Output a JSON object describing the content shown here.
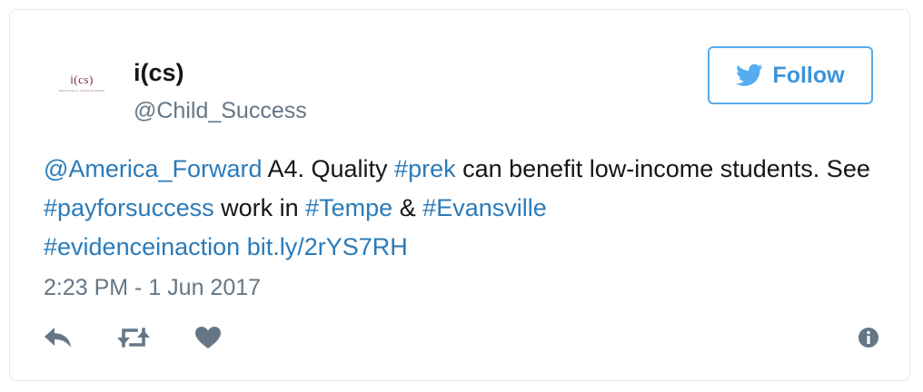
{
  "user": {
    "avatar_logo_text": "i(cs)",
    "avatar_logo_subtext": "INSTITUTE for CHILD SUCCESS",
    "name": "i(cs)",
    "handle": "@Child_Success"
  },
  "follow_button": {
    "label": "Follow",
    "icon": "twitter-bird-icon"
  },
  "tweet": {
    "segments": [
      {
        "text": "@America_Forward",
        "type": "mention"
      },
      {
        "text": " A4. Quality ",
        "type": "text"
      },
      {
        "text": "#prek",
        "type": "hashtag"
      },
      {
        "text": " can benefit low-income students. See ",
        "type": "text"
      },
      {
        "text": "#payforsuccess",
        "type": "hashtag"
      },
      {
        "text": " work in ",
        "type": "text"
      },
      {
        "text": "#Tempe",
        "type": "hashtag"
      },
      {
        "text": " & ",
        "type": "text"
      },
      {
        "text": "#Evansville",
        "type": "hashtag"
      },
      {
        "text": " ",
        "type": "text"
      },
      {
        "text": "#evidenceinaction",
        "type": "hashtag"
      },
      {
        "text": " ",
        "type": "text"
      },
      {
        "text": "bit.ly/2rYS7RH",
        "type": "url"
      }
    ],
    "timestamp": "2:23 PM - 1 Jun 2017"
  },
  "actions": [
    {
      "name": "reply-icon",
      "label": "Reply"
    },
    {
      "name": "retweet-icon",
      "label": "Retweet"
    },
    {
      "name": "like-icon",
      "label": "Like"
    },
    {
      "name": "info-icon",
      "label": "Tweet details"
    }
  ],
  "colors": {
    "link": "#2b7bb9",
    "follow_blue": "#55acee",
    "icon_gray": "#657786",
    "text": "#14171a",
    "border": "#e1e8ed"
  }
}
